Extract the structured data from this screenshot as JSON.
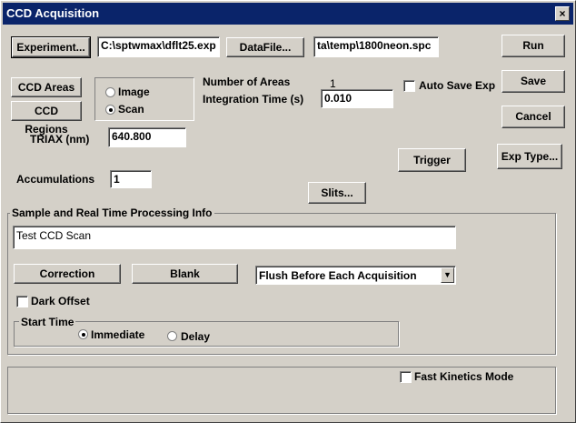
{
  "window": {
    "title": "CCD Acquisition",
    "close": "×"
  },
  "top": {
    "experiment_label": "Experiment...",
    "experiment_path": "C:\\sptwmax\\dflt25.exp",
    "datafile_label": "DataFile...",
    "datafile_path": "ta\\temp\\1800neon.spc"
  },
  "right_buttons": {
    "run": "Run",
    "save": "Save",
    "cancel": "Cancel",
    "exp_type": "Exp Type..."
  },
  "ccd": {
    "areas_label": "CCD Areas",
    "regions_label": "CCD Regions",
    "mode_image": "Image",
    "mode_scan": "Scan",
    "mode_selected": "Scan",
    "number_of_areas_label": "Number of Areas",
    "number_of_areas_value": "1",
    "integration_label": "Integration Time  (s)",
    "integration_value": "0.010",
    "auto_save_label": "Auto Save Exp",
    "auto_save_checked": false,
    "triax_label": "TRIAX (nm)",
    "triax_value": "640.800",
    "trigger_label": "Trigger",
    "accumulations_label": "Accumulations",
    "accumulations_value": "1",
    "slits_label": "Slits..."
  },
  "processing": {
    "group_title": "Sample and Real Time Processing Info",
    "description": "Test CCD Scan",
    "correction_label": "Correction",
    "blank_label": "Blank",
    "flush_selected": "Flush Before Each Acquisition",
    "dark_offset_label": "Dark Offset",
    "dark_offset_checked": false,
    "start_time_title": "Start Time",
    "immediate_label": "Immediate",
    "delay_label": "Delay",
    "start_selected": "Immediate"
  },
  "bottom": {
    "fast_kinetics_label": "Fast Kinetics Mode",
    "fast_kinetics_checked": false
  }
}
